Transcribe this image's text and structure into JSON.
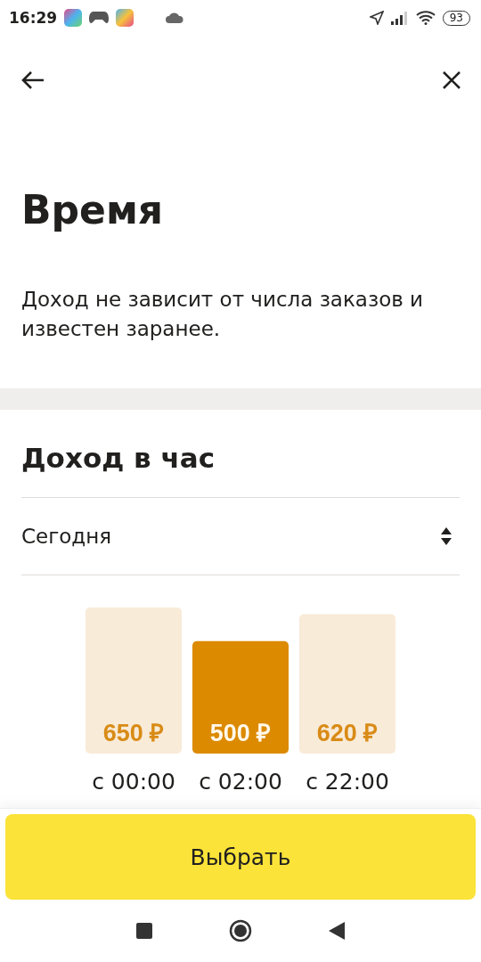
{
  "status_bar": {
    "time": "16:29",
    "battery": "93"
  },
  "title": "Время",
  "description": "Доход не зависит от числа заказов и известен заранее.",
  "section_title": "Доход в час",
  "day_select": {
    "value": "Сегодня"
  },
  "chart_data": {
    "type": "bar",
    "categories": [
      "с 00:00",
      "с 02:00",
      "с 22:00"
    ],
    "values": [
      650,
      500,
      620
    ],
    "data_labels": true,
    "value_labels": [
      "650 ₽",
      "500 ₽",
      "620 ₽"
    ]
  },
  "bars": [
    {
      "selected": false
    },
    {
      "selected": true
    },
    {
      "selected": false
    }
  ],
  "primary_button": "Выбрать"
}
